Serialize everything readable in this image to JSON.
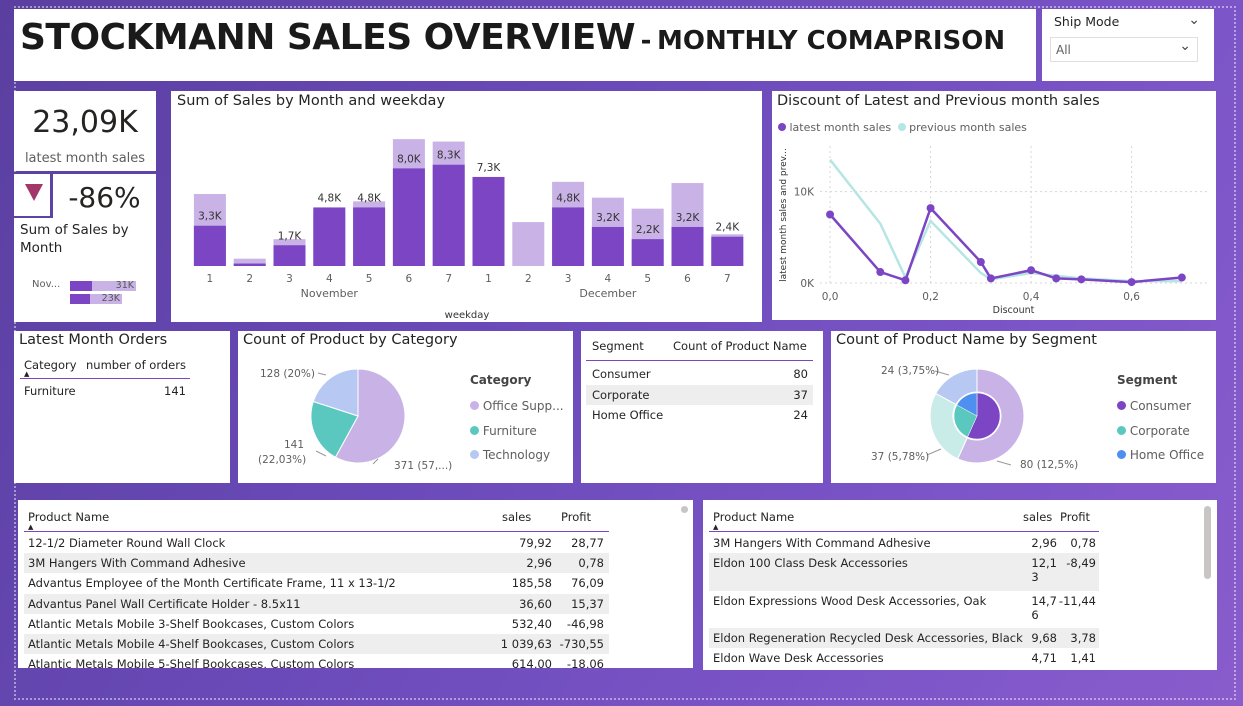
{
  "header": {
    "title_main": "STOCKMANN SALES OVERVIEW",
    "title_sep": "-",
    "title_sub": "MONTHLY COMAPRISON"
  },
  "slicer": {
    "label": "Ship Mode",
    "value": "All"
  },
  "kpi": {
    "value": "23,09K",
    "label": "latest month sales",
    "change": "-86%"
  },
  "mini": {
    "title": "Sum of Sales by Month",
    "label": "Nov...",
    "v1": "31K",
    "v2": "23K"
  },
  "colors": {
    "dark": "#7b45c4",
    "light": "#c9b3e6",
    "teal": "#5bc8c0",
    "blue": "#4f8ff0",
    "accent": "#b0b0e8"
  },
  "bar_chart": {
    "title": "Sum of Sales by Month and weekday",
    "xlabel": "weekday",
    "groups": [
      "November",
      "December"
    ],
    "chart_data": {
      "type": "bar",
      "categories": [
        "1",
        "2",
        "3",
        "4",
        "5",
        "6",
        "7",
        "1",
        "2",
        "3",
        "4",
        "5",
        "6",
        "7"
      ],
      "series": [
        {
          "values": [
            3.3,
            0.2,
            1.7,
            4.8,
            4.8,
            8.0,
            8.3,
            7.3,
            0.0,
            4.8,
            3.2,
            2.2,
            3.2,
            2.4
          ]
        },
        {
          "values": [
            5.9,
            0.6,
            2.2,
            4.5,
            5.3,
            10.4,
            10.2,
            5.5,
            3.6,
            6.9,
            5.6,
            4.7,
            6.8,
            2.6
          ]
        }
      ],
      "labels": [
        "3,3K",
        "",
        "1,7K",
        "4,8K",
        "4,8K",
        "8,0K",
        "8,3K",
        "7,3K",
        "",
        "4,8K",
        "3,2K",
        "2,2K",
        "3,2K",
        "2,4K"
      ]
    }
  },
  "line_chart": {
    "title": "Discount of Latest and Previous month sales",
    "legend": [
      "latest month sales",
      "previous month sales"
    ],
    "ylabel": "latest month sales and prev...",
    "xlabel": "Discount",
    "yticks": [
      "10K",
      "0K"
    ],
    "xticks": [
      "0,0",
      "0,2",
      "0,4",
      "0,6"
    ],
    "chart_data": {
      "type": "line",
      "x": [
        0.0,
        0.1,
        0.15,
        0.2,
        0.3,
        0.32,
        0.4,
        0.45,
        0.5,
        0.6,
        0.7
      ],
      "series": [
        {
          "name": "latest month sales",
          "values": [
            7.5,
            1.2,
            0.3,
            8.2,
            2.3,
            0.5,
            1.4,
            0.5,
            0.4,
            0.1,
            0.6
          ]
        },
        {
          "name": "previous month sales",
          "values": [
            13.5,
            6.5,
            0.6,
            6.8,
            1.1,
            0.4,
            1.1,
            0.8,
            0.5,
            0.2,
            0.2
          ]
        }
      ],
      "xlim": [
        -0.02,
        0.75
      ],
      "ylim": [
        0,
        15
      ]
    }
  },
  "orders": {
    "title": "Latest Month Orders",
    "col1": "Category",
    "col2": "number of orders",
    "row_cat": "Furniture",
    "row_val": "141"
  },
  "pie1": {
    "title": "Count of Product by Category",
    "legend_title": "Category",
    "legend": [
      "Office Supp...",
      "Furniture",
      "Technology"
    ],
    "labels": [
      "128 (20%)",
      "141",
      "(22,03%)",
      "371 (57,...)"
    ],
    "chart_data": {
      "type": "pie",
      "categories": [
        "Office Supplies",
        "Furniture",
        "Technology"
      ],
      "values": [
        371,
        141,
        128
      ]
    }
  },
  "seg_table": {
    "col1": "Segment",
    "col2": "Count of Product Name",
    "rows": [
      {
        "name": "Consumer",
        "val": "80"
      },
      {
        "name": "Corporate",
        "val": "37"
      },
      {
        "name": "Home Office",
        "val": "24"
      }
    ]
  },
  "pie2": {
    "title": "Count of Product Name by Segment",
    "legend_title": "Segment",
    "legend": [
      "Consumer",
      "Corporate",
      "Home Office"
    ],
    "labels": [
      "24 (3,75%)",
      "37 (5,78%)",
      "80 (12,5%)"
    ],
    "chart_data": {
      "type": "pie",
      "categories": [
        "Consumer",
        "Corporate",
        "Home Office"
      ],
      "values": [
        80,
        37,
        24
      ]
    }
  },
  "table1": {
    "cols": [
      "Product Name",
      "sales",
      "Profit"
    ],
    "rows": [
      {
        "name": "12-1/2 Diameter Round Wall Clock",
        "sales": "79,92",
        "profit": "28,77"
      },
      {
        "name": "3M Hangers With Command Adhesive",
        "sales": "2,96",
        "profit": "0,78"
      },
      {
        "name": "Advantus Employee of the Month Certificate Frame, 11 x 13-1/2",
        "sales": "185,58",
        "profit": "76,09"
      },
      {
        "name": "Advantus Panel Wall Certificate Holder - 8.5x11",
        "sales": "36,60",
        "profit": "15,37"
      },
      {
        "name": "Atlantic Metals Mobile 3-Shelf Bookcases, Custom Colors",
        "sales": "532,40",
        "profit": "-46,98"
      },
      {
        "name": "Atlantic Metals Mobile 4-Shelf Bookcases, Custom Colors",
        "sales": "1 039,63",
        "profit": "-730,55"
      },
      {
        "name": "Atlantic Metals Mobile 5-Shelf Bookcases, Custom Colors",
        "sales": "614,00",
        "profit": "-18,06"
      }
    ]
  },
  "table2": {
    "cols": [
      "Product Name",
      "sales",
      "Profit"
    ],
    "rows": [
      {
        "name": "3M Hangers With Command Adhesive",
        "sales": "2,96",
        "profit": "0,78"
      },
      {
        "name": "Eldon 100 Class Desk Accessories",
        "sales": "12,1\n3",
        "profit": "-8,49"
      },
      {
        "name": "Eldon Expressions Wood Desk Accessories, Oak",
        "sales": "14,7\n6",
        "profit": "-11,44"
      },
      {
        "name": "Eldon Regeneration Recycled Desk Accessories, Black",
        "sales": "9,68",
        "profit": "3,78"
      },
      {
        "name": "Eldon Wave Desk Accessories",
        "sales": "4,71",
        "profit": "1,41"
      }
    ]
  }
}
